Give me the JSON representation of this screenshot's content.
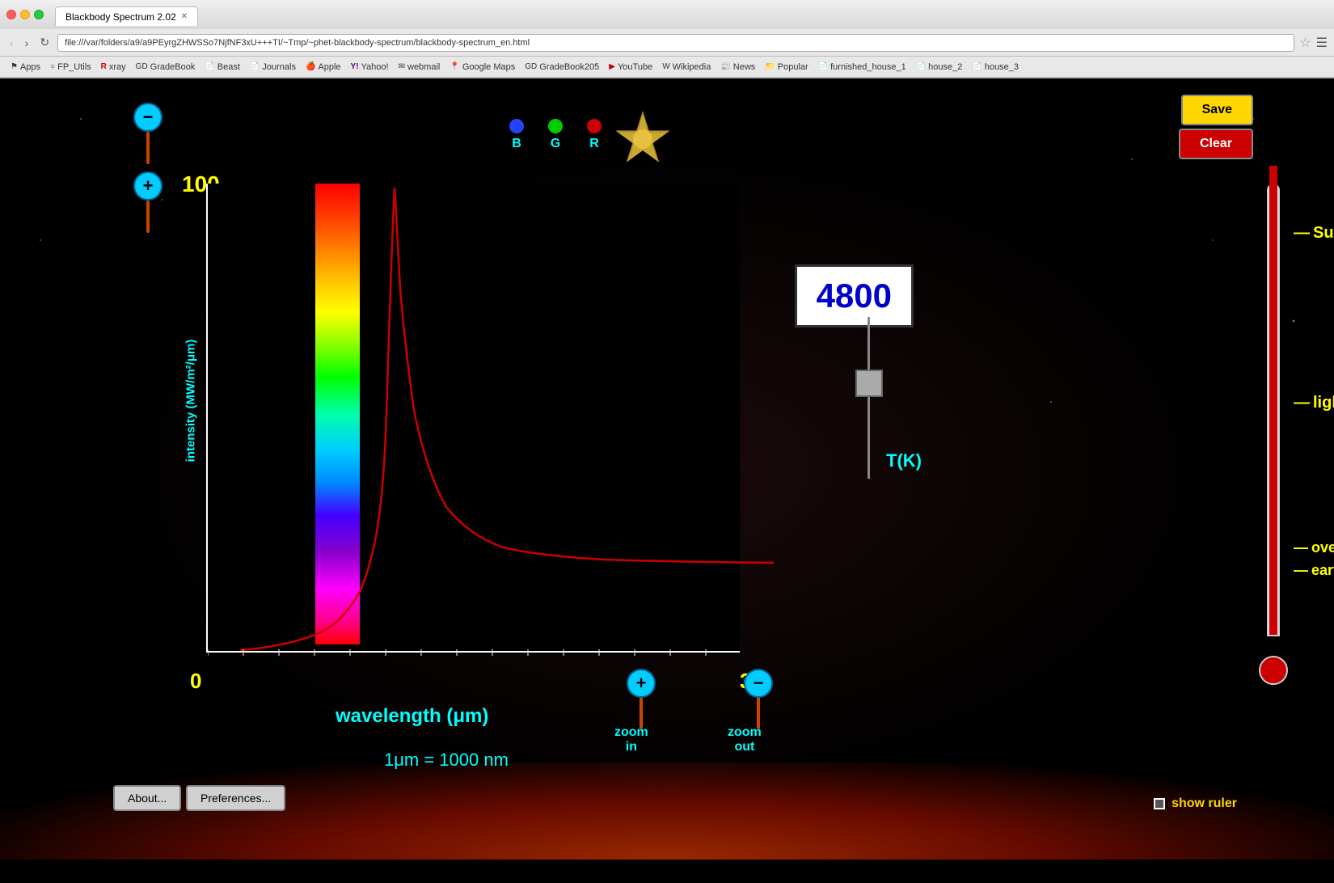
{
  "browser": {
    "tab_title": "Blackbody Spectrum 2.02",
    "url": "file:///var/folders/a9/a9PEyrgZHWSSo7NjfNF3xU+++TI/~Tmp/~phet-blackbody-spectrum/blackbody-spectrum_en.html",
    "nav": {
      "back": "‹",
      "forward": "›",
      "reload": "↻"
    },
    "bookmarks": [
      {
        "label": "Apps",
        "icon": "⚑"
      },
      {
        "label": "FP_Utils",
        "icon": "○"
      },
      {
        "label": "xray",
        "icon": "R"
      },
      {
        "label": "GradeBook",
        "icon": "GD"
      },
      {
        "label": "Beast",
        "icon": "📄"
      },
      {
        "label": "Journals",
        "icon": "📄"
      },
      {
        "label": "Apple",
        "icon": "🍎"
      },
      {
        "label": "Yahoo!",
        "icon": "Y!"
      },
      {
        "label": "webmail",
        "icon": "✉"
      },
      {
        "label": "Google Maps",
        "icon": "📍"
      },
      {
        "label": "GradeBook205",
        "icon": "GD"
      },
      {
        "label": "YouTube",
        "icon": "▶"
      },
      {
        "label": "Wikipedia",
        "icon": "W"
      },
      {
        "label": "News",
        "icon": "📰"
      },
      {
        "label": "Popular",
        "icon": "📁"
      },
      {
        "label": "furnished_house_1",
        "icon": "📄"
      },
      {
        "label": "house_2",
        "icon": "📄"
      },
      {
        "label": "house_3",
        "icon": "📄"
      }
    ]
  },
  "sim": {
    "save_label": "Save",
    "clear_label": "Clear",
    "rgb_labels": [
      "B",
      "G",
      "R"
    ],
    "temperature": "4800",
    "temp_unit": "T(K)",
    "y_axis_label": "intensity (MW/m²/μm)",
    "y_max": "100",
    "x_min": "0",
    "x_max": "3",
    "x_axis_title": "wavelength (μm)",
    "unit_conversion": "1μm  =  1000 nm",
    "zoom_in_label": "zoom\nin",
    "zoom_out_label": "zoom\nout",
    "thermo_labels": [
      "Sun",
      "light bulb",
      "oven",
      "earth"
    ],
    "about_label": "About...",
    "prefs_label": "Preferences...",
    "show_ruler_label": "show ruler"
  }
}
